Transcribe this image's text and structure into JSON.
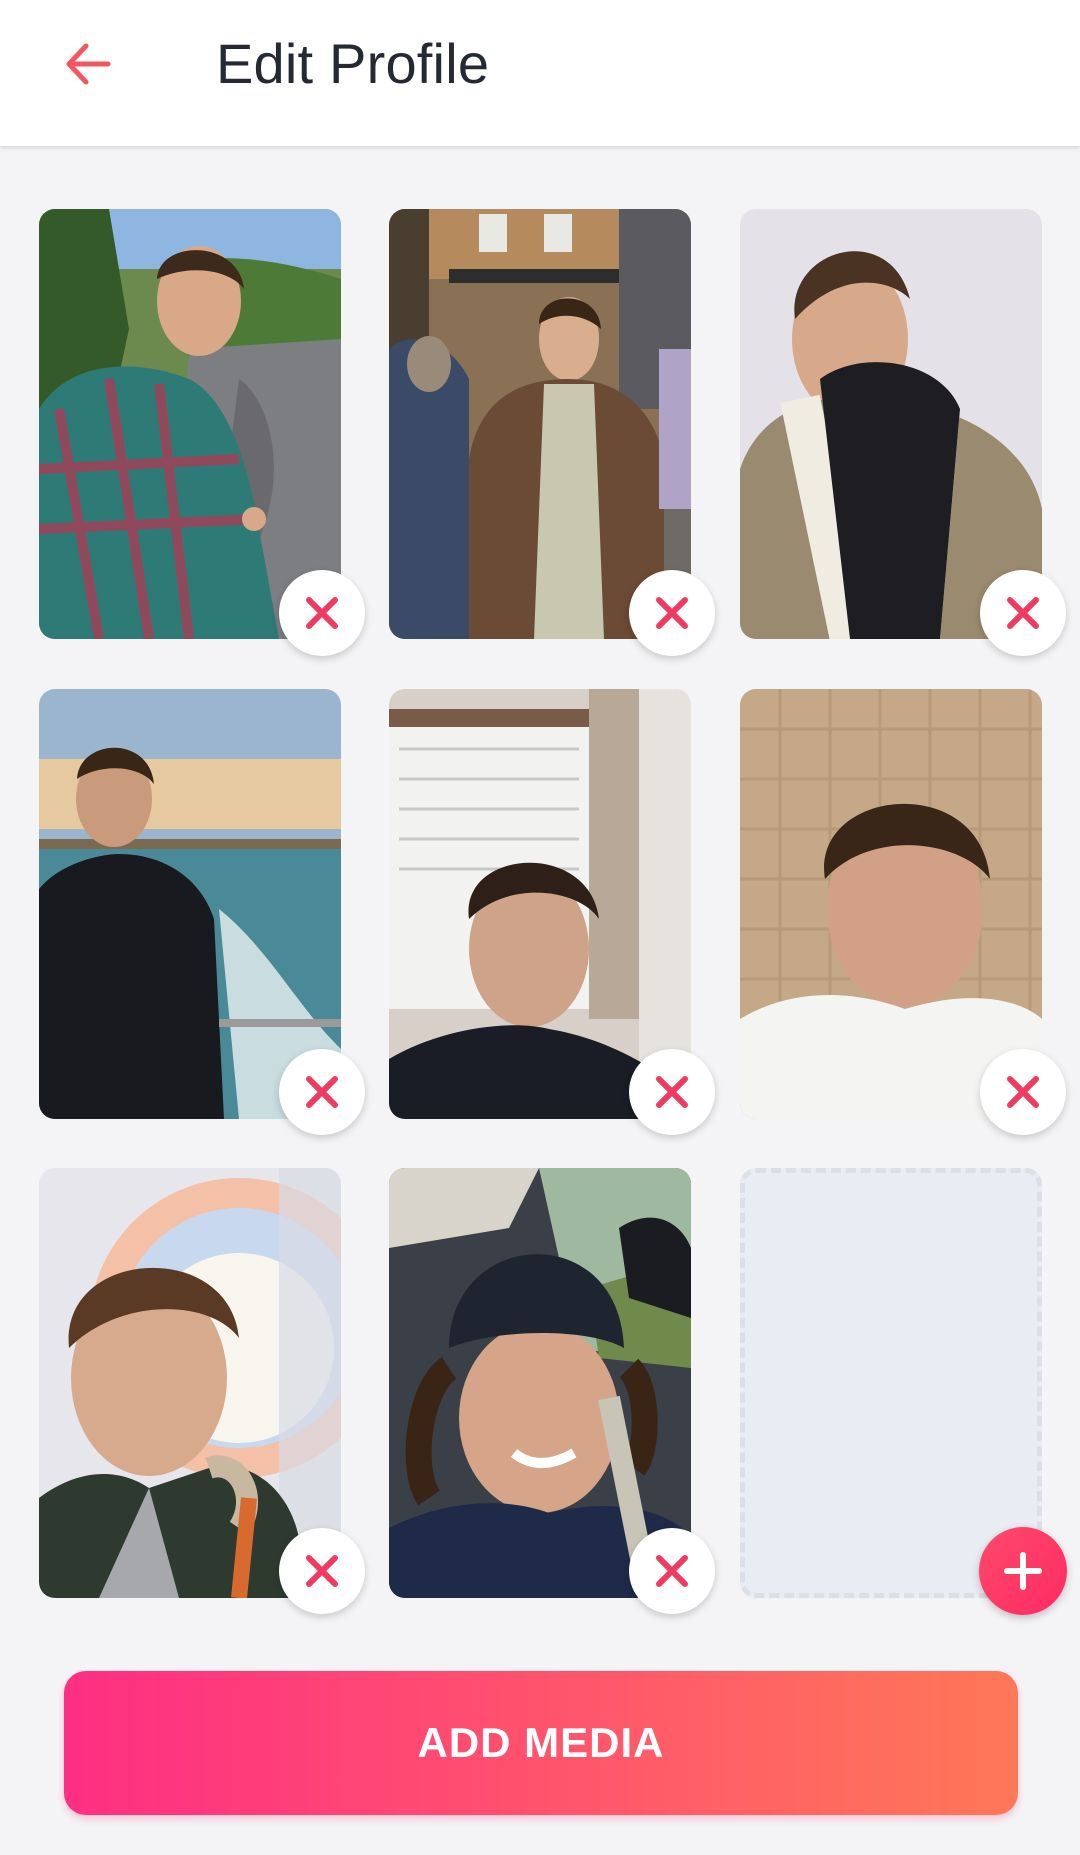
{
  "header": {
    "title": "Edit Profile",
    "back_icon": "arrow-left-icon",
    "back_color": "#f0575f"
  },
  "media": {
    "slots": [
      {
        "type": "photo",
        "scene": "outdoor road, plaid shirt",
        "removable": true
      },
      {
        "type": "photo",
        "scene": "city street, brown jacket",
        "removable": true
      },
      {
        "type": "photo",
        "scene": "studio, sherpa jacket",
        "removable": true
      },
      {
        "type": "photo",
        "scene": "beach at sunset, black t-shirt",
        "removable": true
      },
      {
        "type": "photo",
        "scene": "indoor selfie, window",
        "removable": true
      },
      {
        "type": "photo",
        "scene": "tiled wall selfie, white t-shirt",
        "removable": true
      },
      {
        "type": "photo",
        "scene": "event backdrop, parka",
        "removable": true
      },
      {
        "type": "photo",
        "scene": "car selfie, beanie",
        "removable": true
      },
      {
        "type": "empty",
        "addable": true
      }
    ],
    "remove_icon": "close-icon",
    "remove_color": "#f03a5f",
    "add_icon": "plus-icon",
    "add_color": "#fe2a64"
  },
  "add_media_button": {
    "label": "ADD MEDIA",
    "gradient": [
      "#fe2e83",
      "#ff7857"
    ]
  }
}
